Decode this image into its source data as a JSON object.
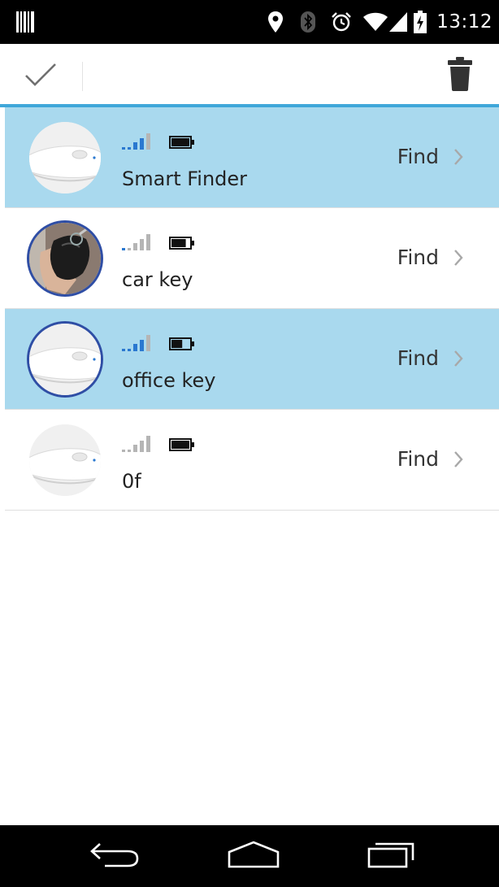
{
  "status_bar": {
    "time": "13:12",
    "icons": [
      "barcode-icon",
      "location-pin-icon",
      "bluetooth-icon",
      "alarm-icon",
      "wifi-icon",
      "cell-signal-icon",
      "battery-charging-icon"
    ]
  },
  "action_bar": {
    "confirm_icon": "checkmark-icon",
    "delete_icon": "trash-icon"
  },
  "colors": {
    "selected_row": "#a9d9ee",
    "accent_line": "#3fa7d9",
    "signal_active": "#2a78d0",
    "signal_inactive": "#b5b5b5"
  },
  "devices": [
    {
      "name": "Smart Finder",
      "find_label": "Find",
      "selected": true,
      "avatar": "tag-device",
      "signal_bars_active": 4,
      "battery_level": 1.0
    },
    {
      "name": "car key",
      "find_label": "Find",
      "selected": false,
      "avatar": "car-key-photo",
      "signal_bars_active": 1,
      "battery_level": 0.8
    },
    {
      "name": "office key",
      "find_label": "Find",
      "selected": true,
      "avatar": "tag-device",
      "signal_bars_active": 4,
      "battery_level": 0.6
    },
    {
      "name": "0f",
      "find_label": "Find",
      "selected": false,
      "avatar": "tag-device",
      "signal_bars_active": 0,
      "battery_level": 1.0
    }
  ],
  "nav_bar": {
    "icons": [
      "back-icon",
      "home-icon",
      "recent-apps-icon"
    ]
  }
}
